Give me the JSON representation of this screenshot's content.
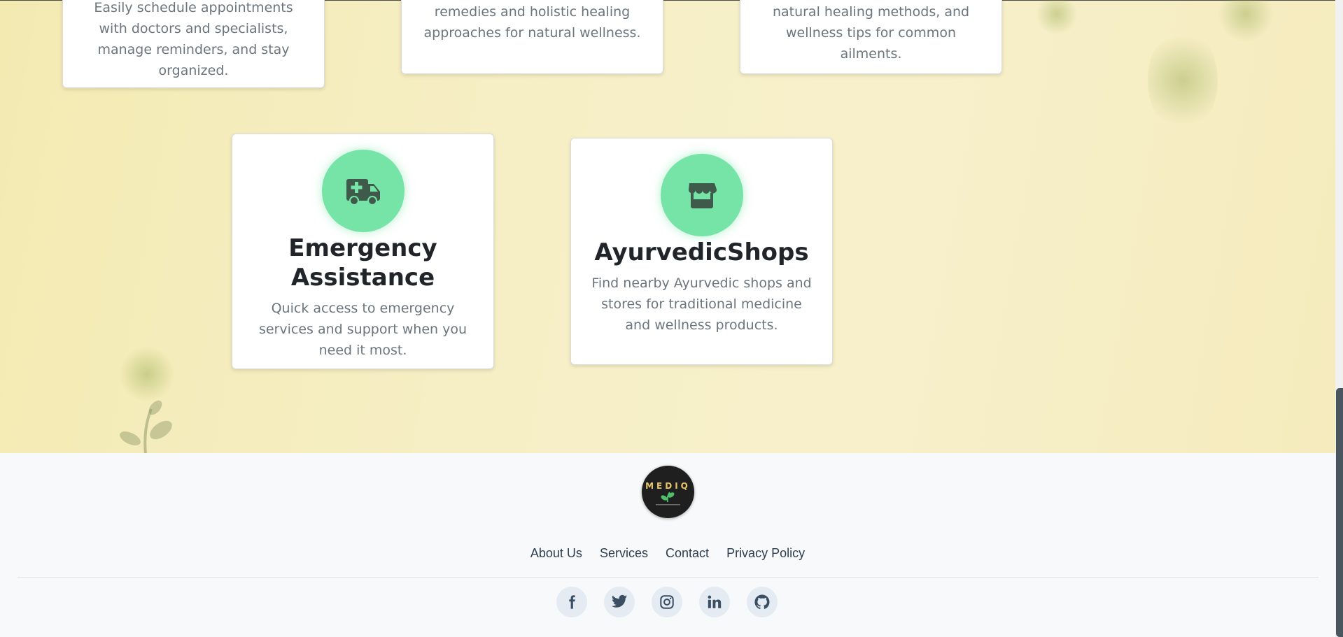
{
  "services": {
    "top_cards": [
      {
        "desc": "Easily schedule appointments with doctors and specialists, manage reminders, and stay organized."
      },
      {
        "desc": "remedies and holistic healing approaches for natural wellness."
      },
      {
        "desc": "natural healing methods, and wellness tips for common ailments."
      }
    ],
    "emergency": {
      "icon": "ambulance-icon",
      "title": "Emergency Assistance",
      "desc": "Quick access to emergency services and support when you need it most."
    },
    "shops": {
      "icon": "store-icon",
      "title": "AyurvedicShops",
      "desc": "Find nearby Ayurvedic shops and stores for traditional medicine and wellness products."
    }
  },
  "footer": {
    "logo_text": "MEDIQ",
    "links": [
      "About Us",
      "Services",
      "Contact",
      "Privacy Policy"
    ],
    "socials": [
      "facebook-icon",
      "twitter-icon",
      "instagram-icon",
      "linkedin-icon",
      "github-icon"
    ]
  },
  "colors": {
    "accent_green": "#76e3a7",
    "icon_dark": "#3f5a4a",
    "text_dark": "#212529",
    "text_muted": "#6c757d",
    "footer_link": "#2c3e50"
  }
}
